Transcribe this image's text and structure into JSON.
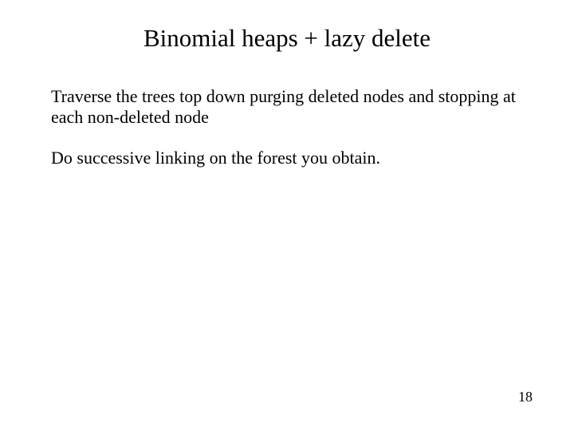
{
  "title": "Binomial heaps + lazy delete",
  "paragraphs": {
    "p1": "Traverse the trees top down purging deleted nodes and stopping at each non-deleted node",
    "p2": "Do successive linking on the forest you obtain."
  },
  "page_number": "18"
}
